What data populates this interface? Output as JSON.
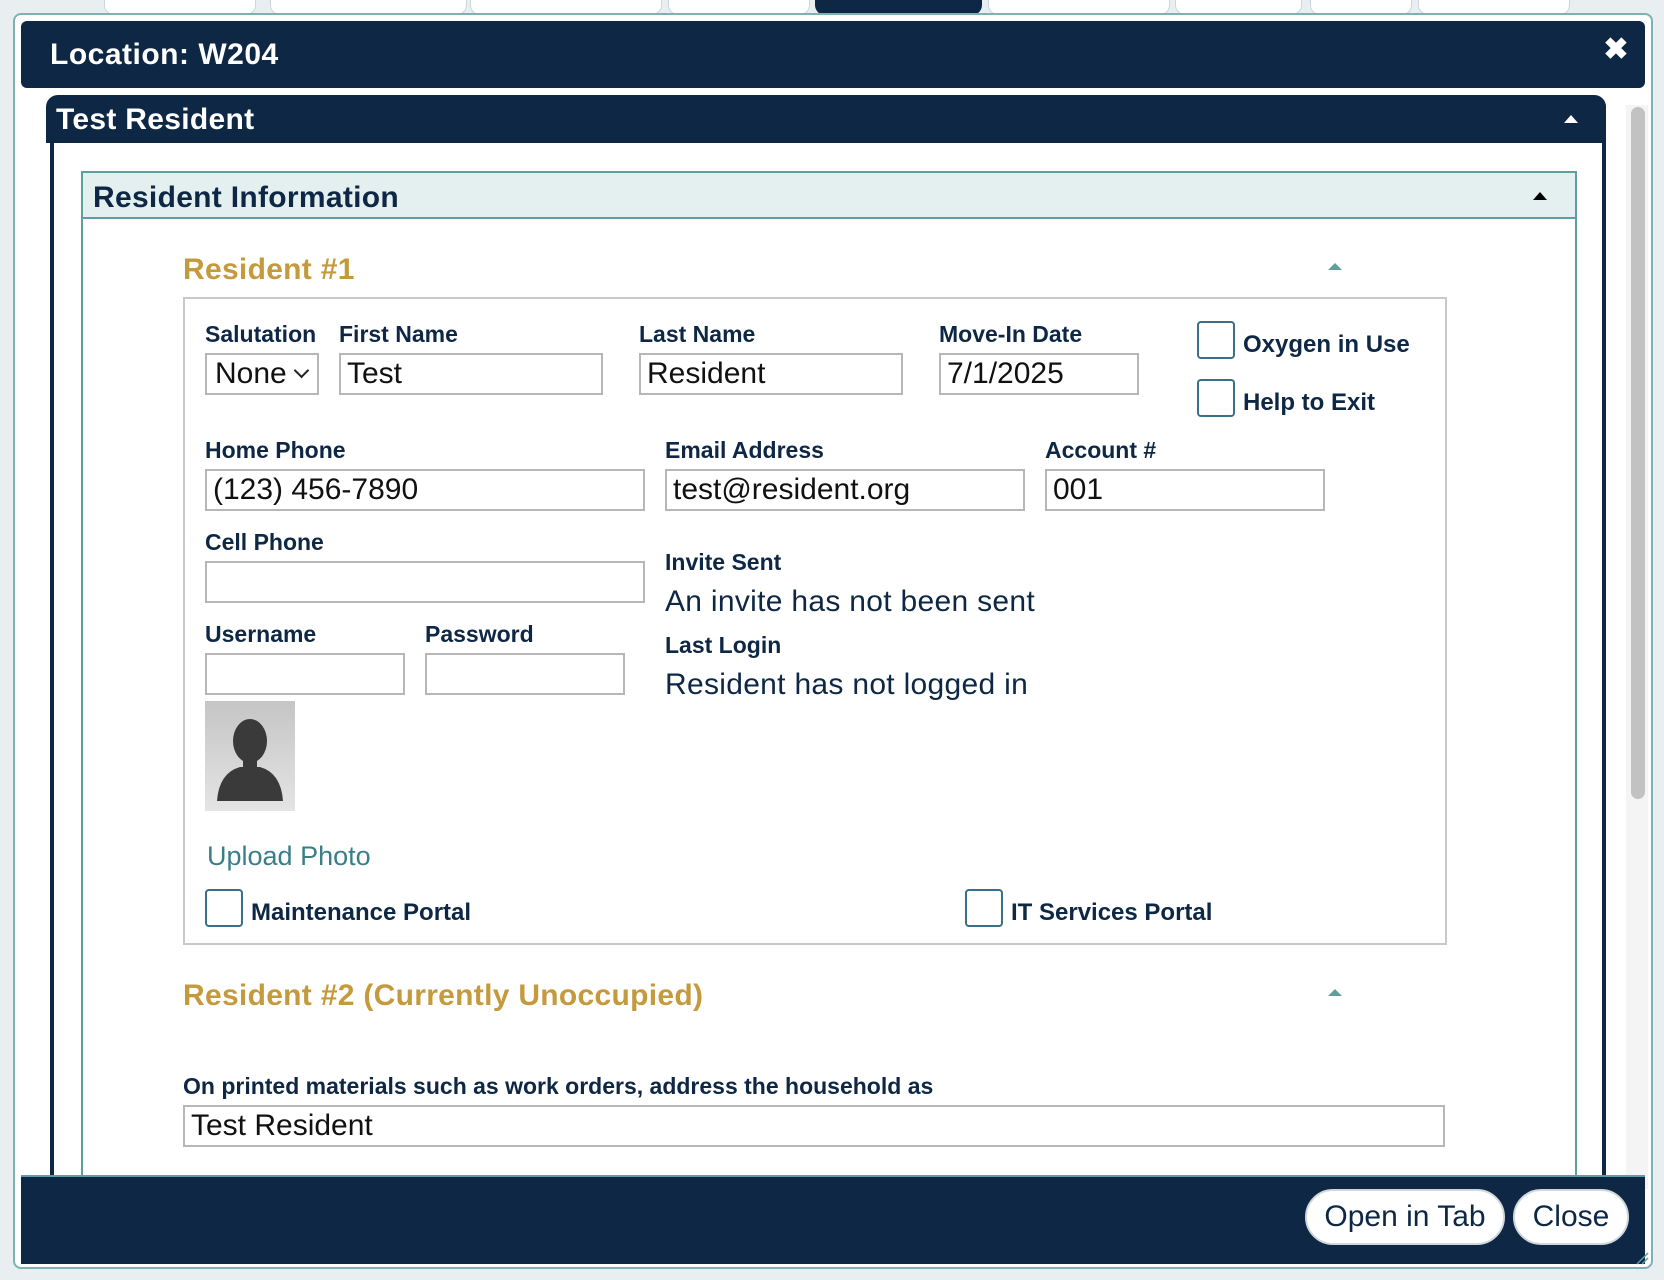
{
  "dialog": {
    "title": "Location: W204",
    "close_symbol": "✖"
  },
  "panel": {
    "title": "Test Resident"
  },
  "section": {
    "title": "Resident Information"
  },
  "resident1": {
    "heading": "Resident #1",
    "salutation": {
      "label": "Salutation",
      "value": "None"
    },
    "first_name": {
      "label": "First Name",
      "value": "Test"
    },
    "last_name": {
      "label": "Last Name",
      "value": "Resident"
    },
    "move_in": {
      "label": "Move-In Date",
      "value": "7/1/2025"
    },
    "oxygen": {
      "label": "Oxygen in Use",
      "checked": false
    },
    "help_exit": {
      "label": "Help to Exit",
      "checked": false
    },
    "home_phone": {
      "label": "Home Phone",
      "value": "(123) 456-7890"
    },
    "email": {
      "label": "Email Address",
      "value": "test@resident.org"
    },
    "account": {
      "label": "Account #",
      "value": "001"
    },
    "cell_phone": {
      "label": "Cell Phone",
      "value": ""
    },
    "invite": {
      "label": "Invite Sent",
      "value": "An invite has not been sent"
    },
    "last_login": {
      "label": "Last Login",
      "value": "Resident has not logged in"
    },
    "username": {
      "label": "Username",
      "value": ""
    },
    "password": {
      "label": "Password",
      "value": ""
    },
    "upload_photo": "Upload Photo",
    "maintenance_portal": {
      "label": "Maintenance Portal",
      "checked": false
    },
    "it_portal": {
      "label": "IT Services Portal",
      "checked": false
    }
  },
  "resident2": {
    "heading": "Resident #2 (Currently Unoccupied)"
  },
  "household": {
    "label": "On printed materials such as work orders, address the household as",
    "value": "Test Resident"
  },
  "footer": {
    "open_in_tab": "Open in Tab",
    "close": "Close"
  },
  "colors": {
    "navy": "#0d2744",
    "gold": "#c49a3c",
    "teal": "#5f9ea0",
    "link": "#3a7f88"
  }
}
